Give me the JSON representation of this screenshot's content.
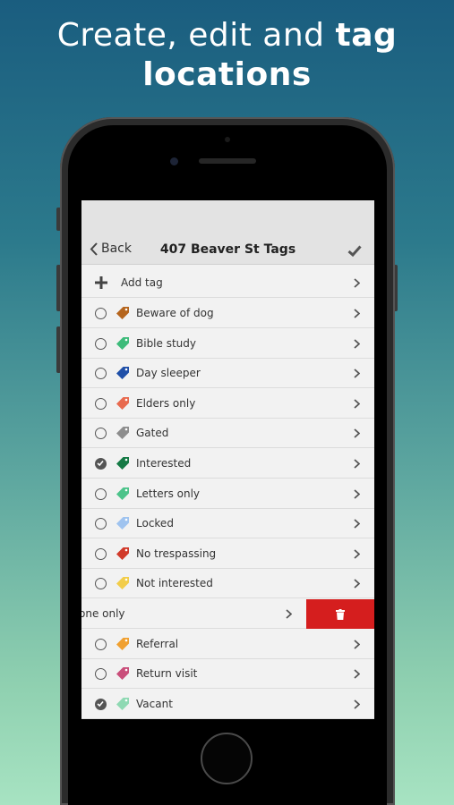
{
  "promo": {
    "headline_part1": "Create, edit and ",
    "headline_bold": "tag",
    "headline_line2": "locations"
  },
  "nav": {
    "back_label": "Back",
    "title": "407 Beaver St Tags"
  },
  "add_tag_label": "Add tag",
  "tags": [
    {
      "label": "Beware of dog",
      "color": "#b5651d",
      "checked": false
    },
    {
      "label": "Bible study",
      "color": "#3dbb7a",
      "checked": false
    },
    {
      "label": "Day sleeper",
      "color": "#1f4fa8",
      "checked": false
    },
    {
      "label": "Elders only",
      "color": "#e86a4f",
      "checked": false
    },
    {
      "label": "Gated",
      "color": "#8d8d8d",
      "checked": false
    },
    {
      "label": "Interested",
      "color": "#157a45",
      "checked": true
    },
    {
      "label": "Letters only",
      "color": "#4cc38a",
      "checked": false
    },
    {
      "label": "Locked",
      "color": "#9fc3ef",
      "checked": false
    },
    {
      "label": "No trespassing",
      "color": "#d13a2a",
      "checked": false
    },
    {
      "label": "Not interested",
      "color": "#f2cd4a",
      "checked": false
    },
    {
      "label": "one only",
      "color": "",
      "checked": false,
      "swiped": true
    },
    {
      "label": "Referral",
      "color": "#f0a030",
      "checked": false
    },
    {
      "label": "Return visit",
      "color": "#c94e7a",
      "checked": false
    },
    {
      "label": "Vacant",
      "color": "#8fd9b3",
      "checked": true
    }
  ],
  "colors": {
    "delete_red": "#d51e1e"
  }
}
